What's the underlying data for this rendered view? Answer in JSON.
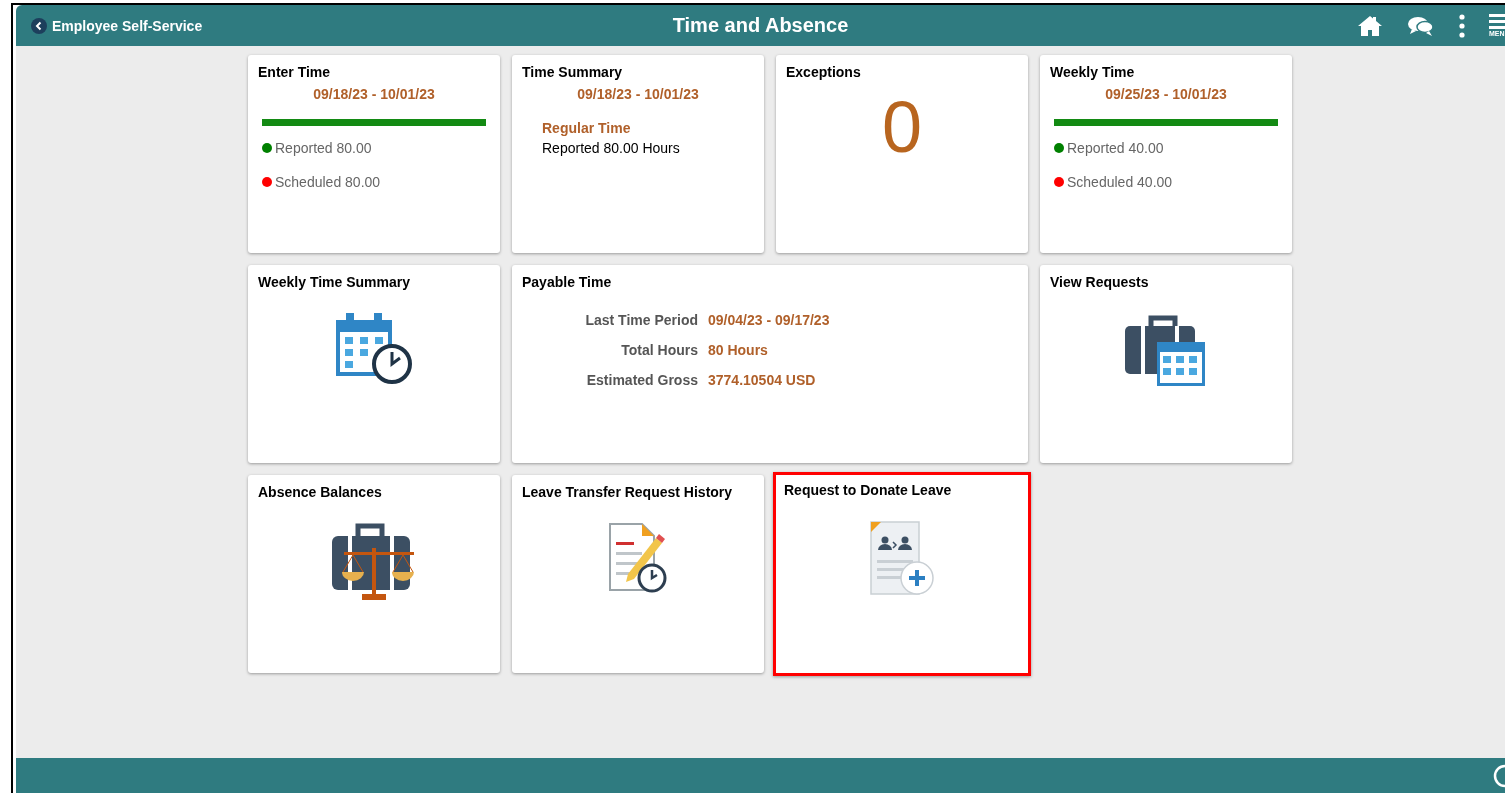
{
  "header": {
    "back_label": "Employee Self-Service",
    "title": "Time and Absence",
    "menu_label": "MEN"
  },
  "tiles": [
    {
      "kind": "progress",
      "title": "Enter Time",
      "period": "09/18/23 - 10/01/23",
      "level": 1,
      "items": [
        {
          "label": "Reported 80.00",
          "color": "#008000"
        },
        {
          "label": "Scheduled 80.00",
          "color": "#ff0000"
        }
      ],
      "highlighted": false
    },
    {
      "kind": "summary",
      "title": "Time Summary",
      "period": "09/18/23 - 10/01/23",
      "heading": "Regular Time",
      "line": "Reported 80.00 Hours",
      "highlighted": false
    },
    {
      "kind": "count",
      "title": "Exceptions",
      "count": "0",
      "highlighted": false
    },
    {
      "kind": "progress",
      "title": "Weekly Time",
      "period": "09/25/23 - 10/01/23",
      "level": 1,
      "items": [
        {
          "label": "Reported 40.00",
          "color": "#008000"
        },
        {
          "label": "Scheduled 40.00",
          "color": "#ff0000"
        }
      ],
      "highlighted": false
    },
    {
      "kind": "icon",
      "title": "Weekly Time Summary",
      "highlighted": false
    },
    {
      "kind": "payable",
      "title": "Payable Time",
      "rows": [
        {
          "label": "Last Time Period",
          "value": "09/04/23 - 09/17/23"
        },
        {
          "label": "Total Hours",
          "value": "80 Hours"
        },
        {
          "label": "Estimated Gross",
          "value": "3774.10504 USD"
        }
      ],
      "highlighted": false
    },
    {
      "kind": "icon",
      "title": "View Requests",
      "highlighted": false
    },
    {
      "kind": "icon",
      "title": "Absence Balances",
      "highlighted": false
    },
    {
      "kind": "icon",
      "title": "Leave Transfer Request History",
      "highlighted": false
    },
    {
      "kind": "icon",
      "title": "Request to Donate Leave",
      "highlighted": true
    }
  ]
}
